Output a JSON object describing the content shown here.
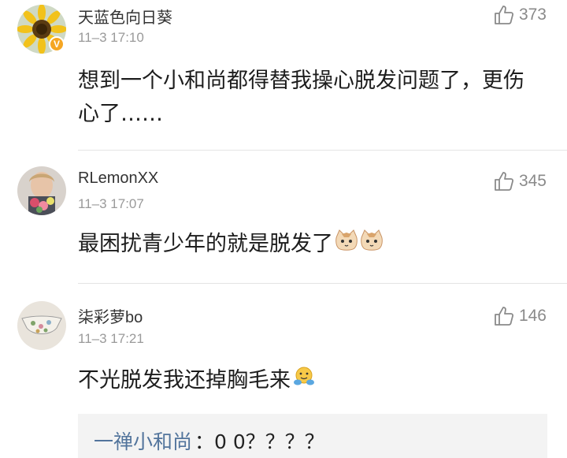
{
  "comments": [
    {
      "username": "天蓝色向日葵",
      "timestamp": "11–3 17:10",
      "likes": "373",
      "text": "想到一个小和尚都得替我操心脱发问题了，更伤心了……",
      "avatar": "sunflower-avatar",
      "verified_badge": "V"
    },
    {
      "username": "RLemonXX",
      "timestamp": "11–3 17:07",
      "likes": "345",
      "text": "最困扰青少年的就是脱发了",
      "avatar": "person-with-flowers-avatar",
      "emojis": [
        "cat-face-emoji",
        "cat-face-emoji"
      ]
    },
    {
      "username": "柒彩萝bo",
      "timestamp": "11–3 17:21",
      "likes": "146",
      "text": "不光脱发我还掉胸毛来",
      "avatar": "floral-fabric-avatar",
      "emojis": [
        "hug-face-emoji"
      ]
    }
  ],
  "reply": {
    "author": "一禅小和尚",
    "separator": "：",
    "text": "0 0？？？？"
  },
  "colors": {
    "username": "#333333",
    "timestamp": "#9a9a9a",
    "like": "#8a8a8a",
    "reply_author": "#52749c",
    "reply_bg": "#f3f3f3",
    "divider": "#e4e4e4"
  }
}
